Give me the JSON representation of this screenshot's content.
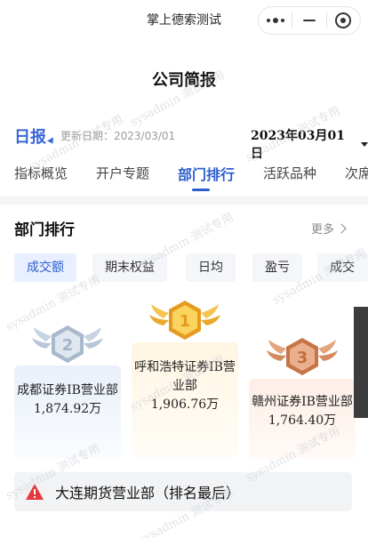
{
  "app": {
    "name": "掌上德索测试"
  },
  "page": {
    "title": "公司简报"
  },
  "report": {
    "type_label": "日报",
    "update_label": "更新日期：2023/03/01",
    "selected_date": "2023年03月01日"
  },
  "tabs": [
    {
      "label": "指标概览"
    },
    {
      "label": "开户专题"
    },
    {
      "label": "部门排行",
      "active": true
    },
    {
      "label": "活跃品种"
    },
    {
      "label": "次席"
    }
  ],
  "section": {
    "title": "部门排行",
    "more_label": "更多"
  },
  "chips": [
    {
      "label": "成交额",
      "active": true
    },
    {
      "label": "期末权益"
    },
    {
      "label": "日均"
    },
    {
      "label": "盈亏"
    },
    {
      "label": "成交量"
    }
  ],
  "podium": {
    "first": {
      "rank": "1",
      "name": "呼和浩特证券IB营业部",
      "amount": "1,906.76万"
    },
    "second": {
      "rank": "2",
      "name": "成都证券IB营业部",
      "amount": "1,874.92万"
    },
    "third": {
      "rank": "3",
      "name": "赣州证券IB营业部",
      "amount": "1,764.40万"
    }
  },
  "last_place": {
    "text": "大连期货营业部（排名最后）"
  },
  "watermark": {
    "text": "sysadmin 测试专用"
  },
  "colors": {
    "accent": "#2e5fce",
    "gold": "#f2b43a",
    "silver": "#b7c6d8",
    "bronze": "#d38a5e",
    "warning": "#e5393d"
  }
}
